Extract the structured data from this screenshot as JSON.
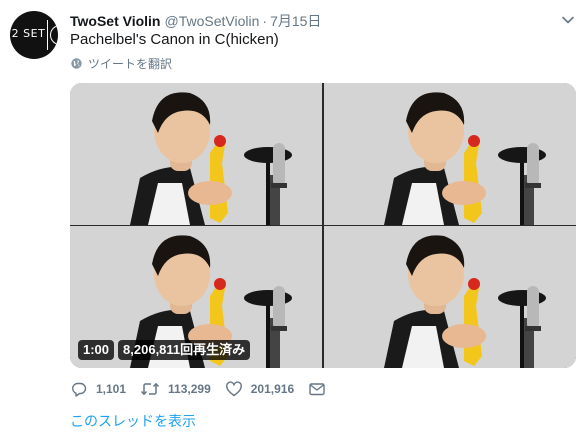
{
  "avatar": {
    "text": "2 SET"
  },
  "header": {
    "display_name": "TwoSet Violin",
    "handle": "@TwoSetViolin",
    "separator": "·",
    "date": "7月15日"
  },
  "tweet": {
    "text": "Pachelbel's Canon in C(hicken)"
  },
  "translate": {
    "label": "ツイートを翻訳",
    "icon": "globe-icon"
  },
  "media": {
    "duration": "1:00",
    "views": "8,206,811回再生済み",
    "tiles": 4
  },
  "actions": {
    "replies": "1,101",
    "retweets": "113,299",
    "likes": "201,916"
  },
  "thread_link": "このスレッドを表示",
  "colors": {
    "link": "#1da1f2",
    "secondary": "#657786",
    "text": "#14171a"
  }
}
